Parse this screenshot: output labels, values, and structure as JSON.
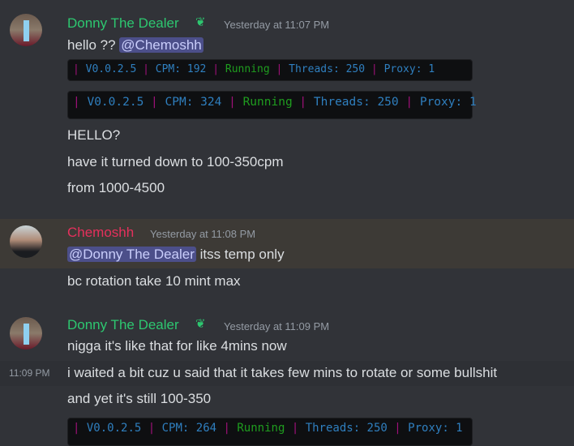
{
  "colors": {
    "donny": "#2dc770",
    "chemoshh": "#e5305c",
    "mention_bg": "#4c4f8a"
  },
  "groups": [
    {
      "author": "Donny The Dealer",
      "timestamp": "Yesterday at 11:07 PM",
      "lines": [
        "hello ??",
        "HELLO?",
        "have it turned down to 100-350cpm",
        "from 1000-4500"
      ],
      "mention": "@Chemoshh"
    },
    {
      "author": "Chemoshh",
      "timestamp": "Yesterday at 11:08 PM",
      "mention": "@Donny The Dealer",
      "lines": [
        " itss temp only",
        "bc rotation take 10 mint max"
      ]
    },
    {
      "author": "Donny The Dealer",
      "timestamp": "Yesterday at 11:09 PM",
      "hover_time": "11:09 PM",
      "lines": [
        "nigga it's like that for like 4mins now",
        "i waited a bit cuz u said that it takes few mins to rotate or some bullshit",
        "and yet it's still 100-350"
      ]
    }
  ],
  "code_blocks": [
    {
      "version": "V0.0.2.5",
      "cpm": "CPM: 192",
      "status": "Running",
      "threads": "Threads: 250",
      "proxy": "Proxy: 1"
    },
    {
      "version": "V0.0.2.5",
      "cpm": "CPM: 324",
      "status": "Running",
      "threads": "Threads: 250",
      "proxy": "Proxy: 1"
    },
    {
      "version": "V0.0.2.5",
      "cpm": "CPM: 264",
      "status": "Running",
      "threads": "Threads: 250",
      "proxy": "Proxy: 1"
    }
  ],
  "pipe": "|"
}
